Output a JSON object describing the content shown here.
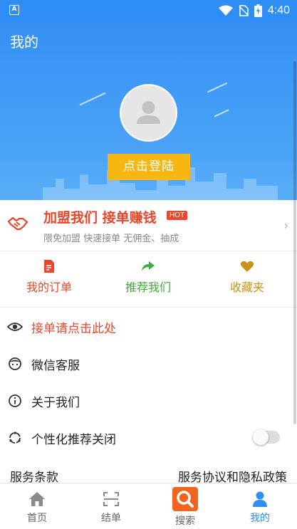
{
  "status_bar": {
    "time": "4:40",
    "app_badge": "A"
  },
  "header": {
    "title": "我的",
    "login_label": "点击登陆"
  },
  "join_banner": {
    "title": "加盟我们 接单赚钱",
    "hot_badge": "HOT",
    "subtitle": "限免加盟 快速接单 无佣金、抽成"
  },
  "shortcuts": [
    {
      "label": "我的订单",
      "icon": "order-icon",
      "color": "#e8472d"
    },
    {
      "label": "推荐我们",
      "icon": "share-icon",
      "color": "#3cae3a"
    },
    {
      "label": "收藏夹",
      "icon": "heart-icon",
      "color": "#c9931a"
    }
  ],
  "menu": [
    {
      "label": "接单请点击此处",
      "icon": "eye-icon"
    },
    {
      "label": "微信客服",
      "icon": "service-icon"
    },
    {
      "label": "关于我们",
      "icon": "info-icon"
    },
    {
      "label": "个性化推荐关闭",
      "icon": "recommend-icon",
      "toggle": false
    }
  ],
  "footer_links": {
    "terms": "服务条款",
    "privacy": "服务协议和隐私政策"
  },
  "tabs": [
    {
      "label": "首页",
      "icon": "home-icon"
    },
    {
      "label": "结单",
      "icon": "scan-icon"
    },
    {
      "label": "搜索",
      "icon": "search-icon"
    },
    {
      "label": "我的",
      "icon": "user-icon",
      "active": true
    }
  ],
  "colors": {
    "brand_blue": "#2f8ef6",
    "accent_red": "#e8472d",
    "login_yellow": "#f7b713",
    "search_orange": "#f0641e"
  }
}
